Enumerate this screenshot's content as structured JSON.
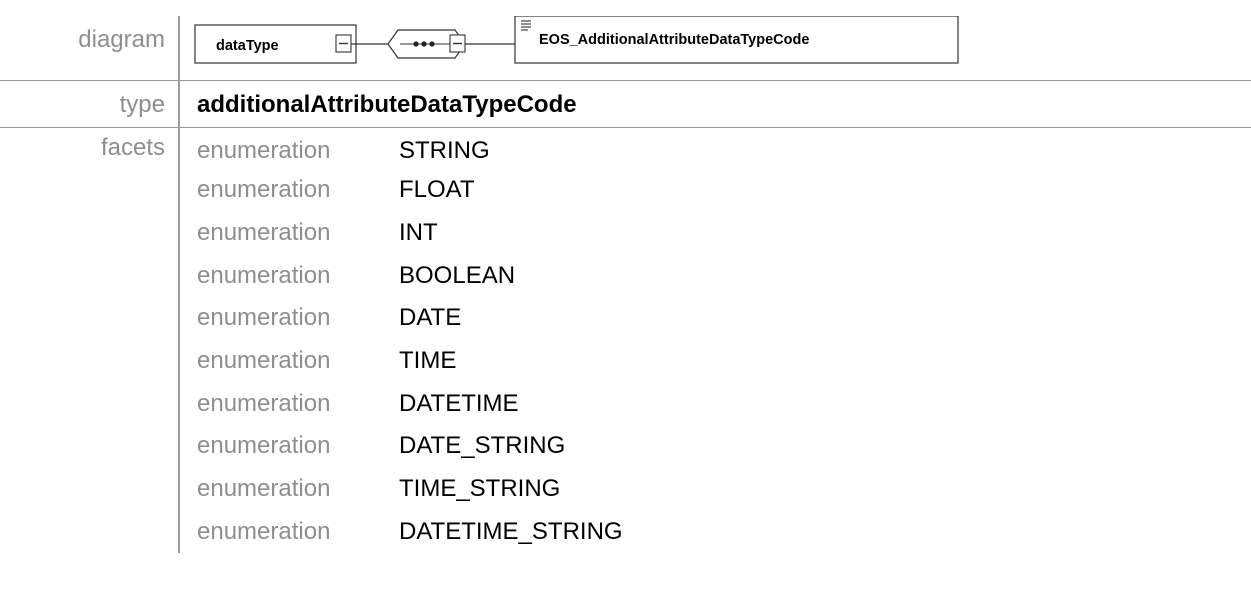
{
  "rows": {
    "diagram": {
      "label": "diagram",
      "element_name": "dataType",
      "type_name": "EOS_AdditionalAttributeDataTypeCode"
    },
    "type": {
      "label": "type",
      "value": "additionalAttributeDataTypeCode"
    },
    "facets": {
      "label": "facets",
      "items": [
        {
          "kind": "enumeration",
          "value": "STRING"
        },
        {
          "kind": "enumeration",
          "value": "FLOAT"
        },
        {
          "kind": "enumeration",
          "value": "INT"
        },
        {
          "kind": "enumeration",
          "value": "BOOLEAN"
        },
        {
          "kind": "enumeration",
          "value": "DATE"
        },
        {
          "kind": "enumeration",
          "value": "TIME"
        },
        {
          "kind": "enumeration",
          "value": "DATETIME"
        },
        {
          "kind": "enumeration",
          "value": "DATE_STRING"
        },
        {
          "kind": "enumeration",
          "value": "TIME_STRING"
        },
        {
          "kind": "enumeration",
          "value": "DATETIME_STRING"
        }
      ]
    }
  },
  "colors": {
    "label_text": "#8e8e8e",
    "border": "#9a9a9a"
  }
}
